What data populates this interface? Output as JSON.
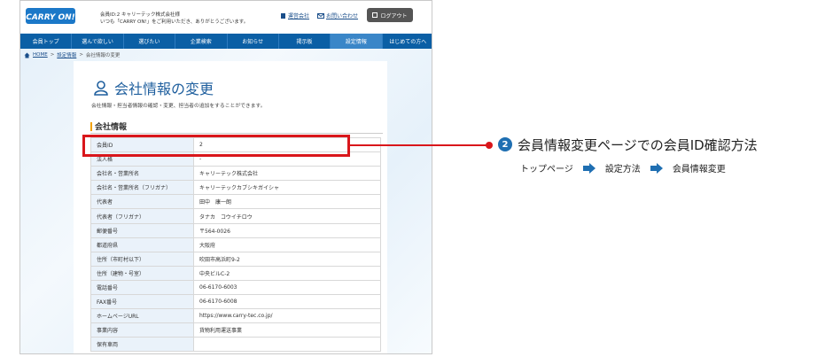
{
  "header": {
    "greeting_line1": "会員ID:2 キャリーテック株式会社様",
    "greeting_line2": "いつも「CARRY ON!」をご利用いただき、ありがとうございます。",
    "links": [
      "運営会社",
      "お問い合わせ"
    ],
    "logout_label": "ログアウト",
    "logo_text": "CARRY ON!"
  },
  "nav": {
    "items": [
      {
        "label": "会員トップ"
      },
      {
        "label": "選んで欲しい"
      },
      {
        "label": "選びたい"
      },
      {
        "label": "企業検索"
      },
      {
        "label": "お知らせ"
      },
      {
        "label": "掲示板"
      },
      {
        "label": "設定情報"
      },
      {
        "label": "はじめての方へ"
      }
    ]
  },
  "breadcrumb": {
    "home": "HOME",
    "sep": ">",
    "parent": "設定情報",
    "current": "会社情報の変更"
  },
  "page": {
    "title": "会社情報の変更",
    "description": "会社情報・担当者情報の確認・変更、担当者の追加をすることができます。",
    "section_title": "会社情報"
  },
  "table": {
    "rows": [
      {
        "key": "会員ID",
        "value": "2"
      },
      {
        "key": "法人格",
        "value": "-"
      },
      {
        "key": "会社名・営業所名",
        "value": "キャリーテック株式会社"
      },
      {
        "key": "会社名・営業所名（フリガナ）",
        "value": "キャリーテックカブシキガイシャ"
      },
      {
        "key": "代表者",
        "value": "田中　康一朗"
      },
      {
        "key": "代表者（フリガナ）",
        "value": "タナカ　コウイチロウ"
      },
      {
        "key": "郵便番号",
        "value": "〒564-0026"
      },
      {
        "key": "都道府県",
        "value": "大阪府"
      },
      {
        "key": "住所（市町村以下）",
        "value": "吹田市高浜町9-2"
      },
      {
        "key": "住所（建物・号室）",
        "value": "中央ビルC-2"
      },
      {
        "key": "電話番号",
        "value": "06-6170-6003"
      },
      {
        "key": "FAX番号",
        "value": "06-6170-6008"
      },
      {
        "key": "ホームページURL",
        "value": "https://www.carry-tec.co.jp/"
      },
      {
        "key": "事業内容",
        "value": "貨物利用運送事業"
      },
      {
        "key": "保有車両",
        "value": ""
      }
    ]
  },
  "annotation": {
    "step_number": "2",
    "title": "会員情報変更ページでの会員ID確認方法",
    "path": [
      "トップページ",
      "設定方法",
      "会員情報変更"
    ],
    "accent_color": "#d9161b",
    "step_color": "#1f6fb2"
  }
}
